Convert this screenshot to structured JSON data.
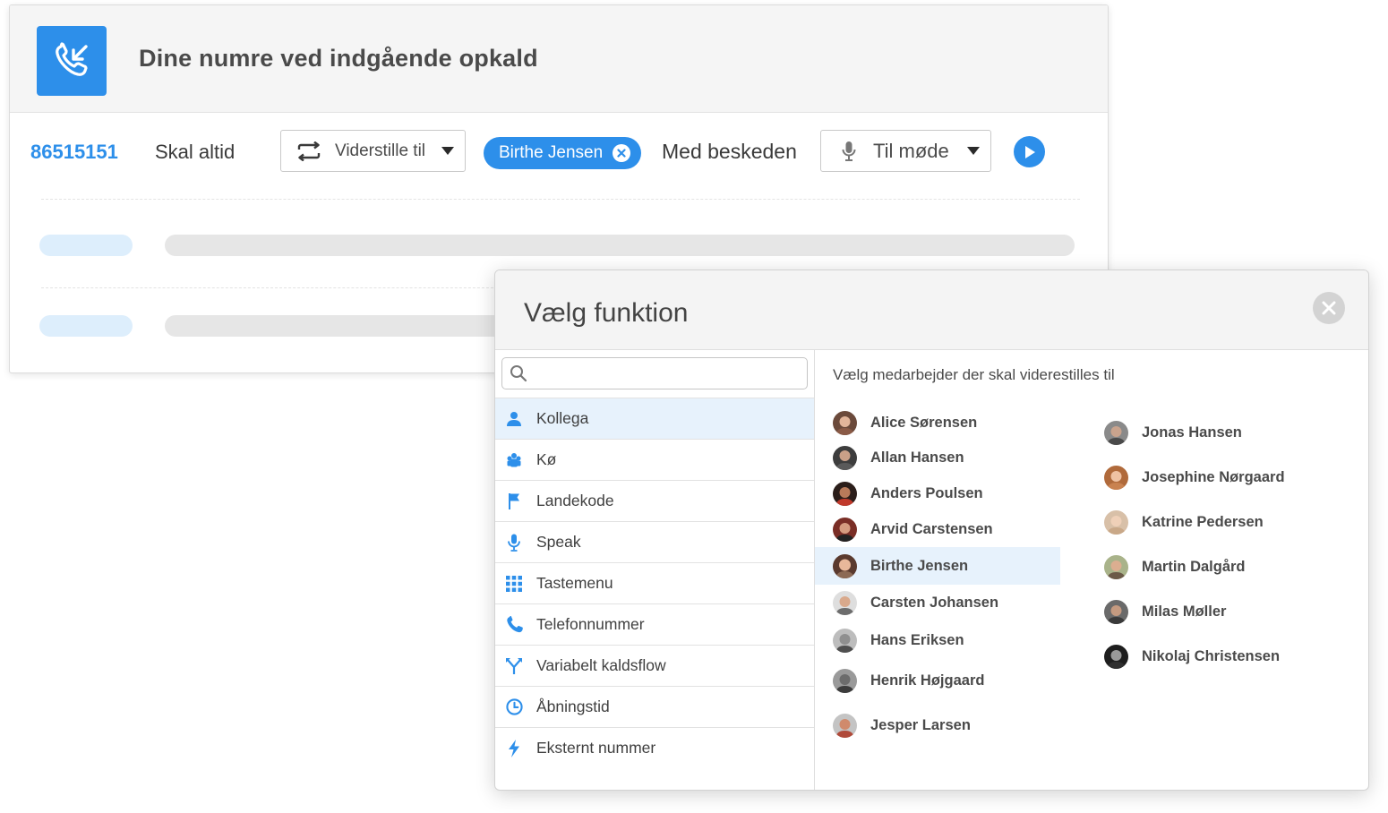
{
  "card": {
    "title": "Dine numre ved indgående opkald",
    "icon": "incoming-call-icon",
    "rule": {
      "number": "86515151",
      "condition": "Skal altid",
      "action_select": {
        "icon": "repeat-icon",
        "value": "Viderstille til"
      },
      "target_chip": {
        "label": "Birthe Jensen"
      },
      "message_label": "Med beskeden",
      "message_select": {
        "icon": "microphone-icon",
        "value": "Til møde"
      },
      "play_icon": "play-icon"
    }
  },
  "modal": {
    "title": "Vælg funktion",
    "close_icon": "close-icon",
    "search": {
      "placeholder": "",
      "value": ""
    },
    "menu": [
      {
        "label": "Kollega",
        "icon": "person-icon",
        "active": true
      },
      {
        "label": "Kø",
        "icon": "queue-icon",
        "active": false
      },
      {
        "label": "Landekode",
        "icon": "flag-icon",
        "active": false
      },
      {
        "label": "Speak",
        "icon": "microphone-icon",
        "active": false
      },
      {
        "label": "Tastemenu",
        "icon": "keypad-icon",
        "active": false
      },
      {
        "label": "Telefonnummer",
        "icon": "phone-icon",
        "active": false
      },
      {
        "label": "Variabelt kaldsflow",
        "icon": "split-arrow-icon",
        "active": false
      },
      {
        "label": "Åbningstid",
        "icon": "clock-icon",
        "active": false
      },
      {
        "label": "Eksternt nummer",
        "icon": "lightning-icon",
        "active": false
      }
    ],
    "instruction": "Vælg medarbejder der skal viderestilles til",
    "employees_col1": [
      {
        "name": "Alice Sørensen",
        "selected": false
      },
      {
        "name": "Allan Hansen",
        "selected": false
      },
      {
        "name": "Anders Poulsen",
        "selected": false
      },
      {
        "name": "Arvid Carstensen",
        "selected": false
      },
      {
        "name": "Birthe Jensen",
        "selected": true
      },
      {
        "name": "Carsten Johansen",
        "selected": false
      },
      {
        "name": "Hans Eriksen",
        "selected": false
      },
      {
        "name": "Henrik Højgaard",
        "selected": false
      },
      {
        "name": "Jesper Larsen",
        "selected": false
      }
    ],
    "employees_col2": [
      {
        "name": "Jonas Hansen",
        "selected": false
      },
      {
        "name": "Josephine Nørgaard",
        "selected": false
      },
      {
        "name": "Katrine Pedersen",
        "selected": false
      },
      {
        "name": "Martin Dalgård",
        "selected": false
      },
      {
        "name": "Milas Møller",
        "selected": false
      },
      {
        "name": "Nikolaj Christensen",
        "selected": false
      }
    ],
    "colors": {
      "accent": "#2d8fea",
      "selected_bg": "#e7f2fc"
    }
  }
}
